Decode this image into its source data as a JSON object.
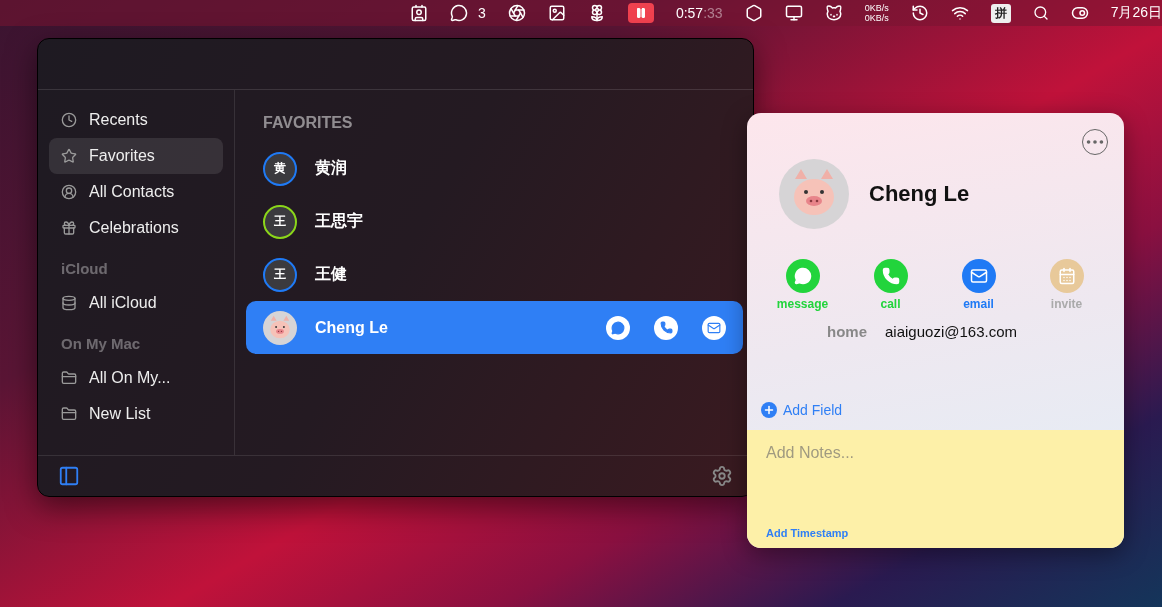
{
  "menu_bar": {
    "chat_count": "3",
    "timer": {
      "elapsed": "0:57",
      "seconds": ":33"
    },
    "net_speed": {
      "upload": "0KB/s",
      "download": "0KB/s"
    },
    "input_method": "拼",
    "date": "7月26日"
  },
  "sidebar": {
    "sections": [
      {
        "items": [
          {
            "label": "Recents",
            "selected": false
          },
          {
            "label": "Favorites",
            "selected": true
          },
          {
            "label": "All Contacts",
            "selected": false
          },
          {
            "label": "Celebrations",
            "selected": false
          }
        ]
      },
      {
        "title": "iCloud",
        "items": [
          {
            "label": "All iCloud",
            "selected": false
          }
        ]
      },
      {
        "title": "On My Mac",
        "items": [
          {
            "label": "All On My...",
            "selected": false
          },
          {
            "label": "New List",
            "selected": false
          }
        ]
      }
    ]
  },
  "favorites": {
    "title": "FAVORITES",
    "contacts": [
      {
        "name": "黄润",
        "initial": "黄",
        "kind": "initials",
        "color": "#1f7af5",
        "selected": false
      },
      {
        "name": "王思宇",
        "initial": "王",
        "kind": "initials",
        "color": "#8bd61a",
        "selected": false
      },
      {
        "name": "王健",
        "initial": "王",
        "kind": "initials",
        "color": "#1f7af5",
        "selected": false
      },
      {
        "name": "Cheng Le",
        "kind": "photo",
        "selected": true
      }
    ]
  },
  "card": {
    "name": "Cheng Le",
    "actions": [
      {
        "label": "message",
        "color": "#22d43c",
        "disabled": false
      },
      {
        "label": "call",
        "color": "#22d43c",
        "disabled": false
      },
      {
        "label": "email",
        "color": "#1f7af5",
        "disabled": false
      },
      {
        "label": "invite",
        "color": "#e8c99a",
        "disabled": true
      }
    ],
    "fields": [
      {
        "label": "home",
        "value": "aiaiguozi@163.com"
      }
    ],
    "add_field": "Add Field",
    "notes_placeholder": "Add Notes...",
    "add_timestamp": "Add Timestamp"
  }
}
